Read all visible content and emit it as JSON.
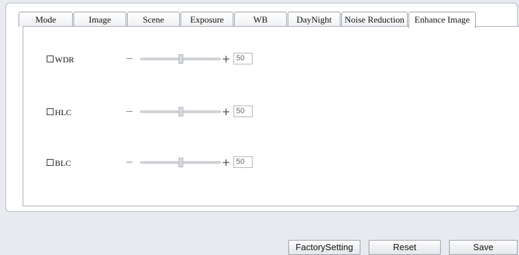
{
  "tabs": [
    {
      "label": "Mode"
    },
    {
      "label": "Image"
    },
    {
      "label": "Scene"
    },
    {
      "label": "Exposure"
    },
    {
      "label": "WB"
    },
    {
      "label": "DayNight"
    },
    {
      "label": "Noise Reduction"
    },
    {
      "label": "Enhance Image",
      "active": true
    }
  ],
  "settings": [
    {
      "label": "WDR",
      "checked": false,
      "value": "50",
      "slider_fraction": 0.5
    },
    {
      "label": "HLC",
      "checked": false,
      "value": "50",
      "slider_fraction": 0.5
    },
    {
      "label": "BLC",
      "checked": false,
      "value": "50",
      "slider_fraction": 0.5
    }
  ],
  "footer": {
    "factory_label": "FactorySetting",
    "reset_label": "Reset",
    "save_label": "Save"
  }
}
